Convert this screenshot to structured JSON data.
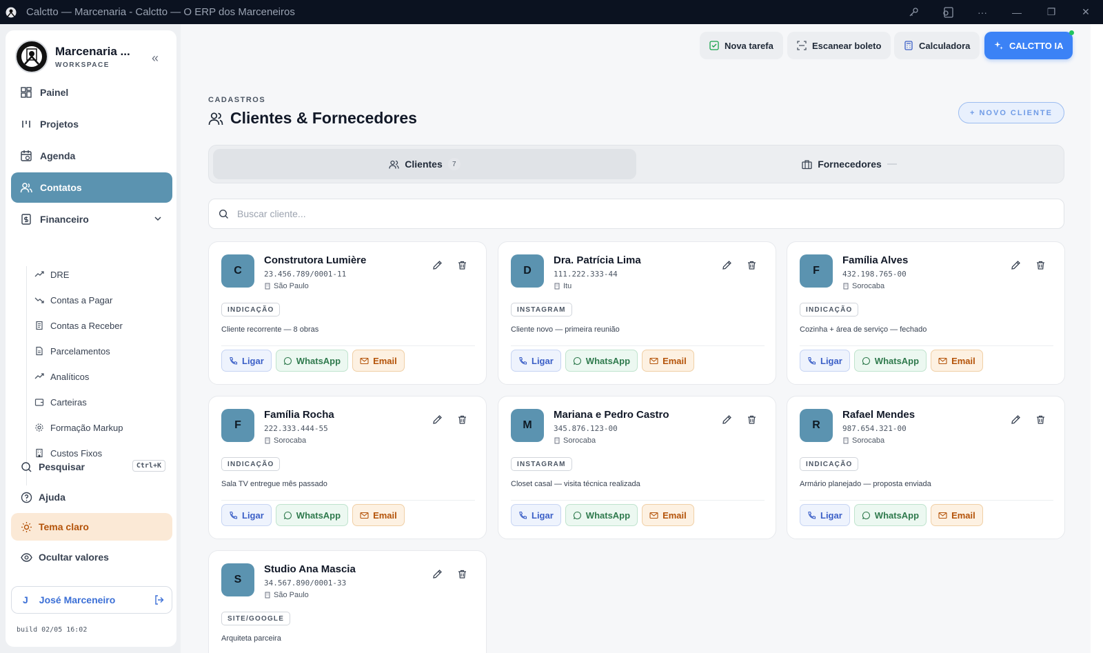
{
  "window": {
    "title": "Calctto — Marcenaria - Calctto — O ERP dos Marceneiros",
    "controls": [
      "key-icon",
      "cast-icon",
      "more-icon",
      "minimize-icon",
      "restore-icon",
      "close-icon"
    ]
  },
  "sidebar": {
    "brand_name": "Marcenaria ...",
    "brand_sub": "WORKSPACE",
    "nav": [
      {
        "label": "Painel",
        "icon": "grid-icon"
      },
      {
        "label": "Projetos",
        "icon": "projects-icon"
      },
      {
        "label": "Agenda",
        "icon": "calendar-icon"
      },
      {
        "label": "Contatos",
        "icon": "users-icon",
        "active": true
      },
      {
        "label": "Financeiro",
        "icon": "finance-icon",
        "expanded": true
      }
    ],
    "financeiro_items": [
      {
        "label": "DRE",
        "icon": "trend-up-icon"
      },
      {
        "label": "Contas a Pagar",
        "icon": "trend-down-icon"
      },
      {
        "label": "Contas a Receber",
        "icon": "receipt-icon"
      },
      {
        "label": "Parcelamentos",
        "icon": "file-icon"
      },
      {
        "label": "Analíticos",
        "icon": "trend-up-icon"
      },
      {
        "label": "Carteiras",
        "icon": "wallet-icon"
      },
      {
        "label": "Formação Markup",
        "icon": "gear-icon"
      },
      {
        "label": "Custos Fixos",
        "icon": "building-icon"
      }
    ],
    "search_label": "Pesquisar",
    "search_shortcut": "Ctrl+K",
    "help_label": "Ajuda",
    "theme_label": "Tema claro",
    "hide_values_label": "Ocultar valores",
    "user_initial": "J",
    "user_name": "José Marceneiro",
    "build": "build 02/05 16:02"
  },
  "toolbar": {
    "new_task": "Nova tarefa",
    "scan_boleto": "Escanear boleto",
    "calculator": "Calculadora",
    "ai": "CALCTTO IA"
  },
  "page": {
    "eyebrow": "CADASTROS",
    "title": "Clientes & Fornecedores",
    "new_client": "+ NOVO CLIENTE"
  },
  "tabs": [
    {
      "label": "Clientes",
      "count": "7",
      "active": true
    },
    {
      "label": "Fornecedores",
      "count": ""
    }
  ],
  "search": {
    "placeholder": "Buscar cliente...",
    "value": ""
  },
  "actions": {
    "call": "Ligar",
    "whatsapp": "WhatsApp",
    "email": "Email"
  },
  "clients": [
    {
      "initial": "C",
      "name": "Construtora Lumière",
      "doc": "23.456.789/0001-11",
      "city": "São Paulo",
      "tag": "INDICAÇÃO",
      "note": "Cliente recorrente — 8 obras"
    },
    {
      "initial": "D",
      "name": "Dra. Patrícia Lima",
      "doc": "111.222.333-44",
      "city": "Itu",
      "tag": "INSTAGRAM",
      "note": "Cliente novo — primeira reunião"
    },
    {
      "initial": "F",
      "name": "Família Alves",
      "doc": "432.198.765-00",
      "city": "Sorocaba",
      "tag": "INDICAÇÃO",
      "note": "Cozinha + área de serviço — fechado"
    },
    {
      "initial": "F",
      "name": "Família Rocha",
      "doc": "222.333.444-55",
      "city": "Sorocaba",
      "tag": "INDICAÇÃO",
      "note": "Sala TV entregue mês passado"
    },
    {
      "initial": "M",
      "name": "Mariana e Pedro Castro",
      "doc": "345.876.123-00",
      "city": "Sorocaba",
      "tag": "INSTAGRAM",
      "note": "Closet casal — visita técnica realizada"
    },
    {
      "initial": "R",
      "name": "Rafael Mendes",
      "doc": "987.654.321-00",
      "city": "Sorocaba",
      "tag": "INDICAÇÃO",
      "note": "Armário planejado — proposta enviada"
    },
    {
      "initial": "S",
      "name": "Studio Ana Mascia",
      "doc": "34.567.890/0001-33",
      "city": "São Paulo",
      "tag": "SITE/GOOGLE",
      "note": "Arquiteta parceira"
    }
  ],
  "colors": {
    "accent": "#5b93b0",
    "primary": "#3b82f6",
    "theme_bg": "#fbe9d6"
  }
}
